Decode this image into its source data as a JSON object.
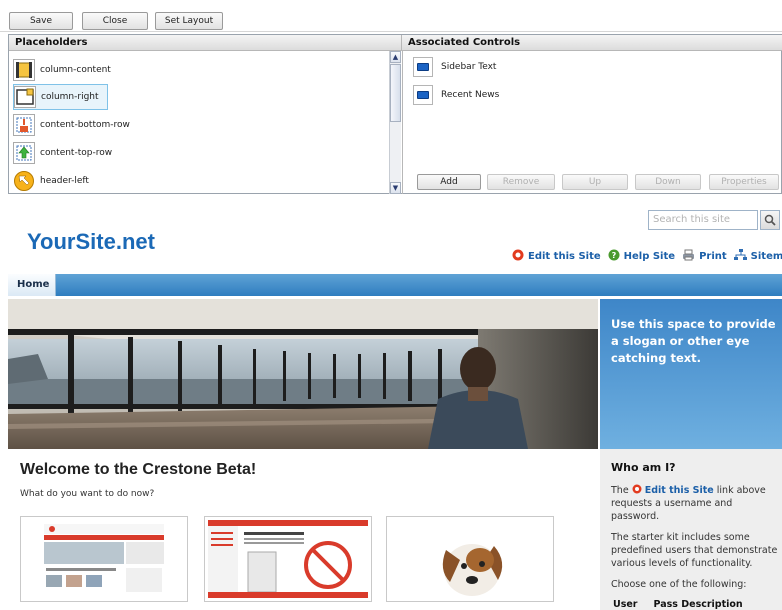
{
  "toolbar": {
    "save": "Save",
    "close": "Close",
    "set_layout": "Set Layout"
  },
  "placeholders": {
    "title": "Placeholders",
    "items": [
      {
        "label": "column-content",
        "icon": "column-content-icon",
        "selected": false
      },
      {
        "label": "column-right",
        "icon": "column-right-icon",
        "selected": true
      },
      {
        "label": "content-bottom-row",
        "icon": "content-bottom-row-icon",
        "selected": false
      },
      {
        "label": "content-top-row",
        "icon": "content-top-row-icon",
        "selected": false
      },
      {
        "label": "header-left",
        "icon": "header-left-icon",
        "selected": false
      }
    ]
  },
  "associated_controls": {
    "title": "Associated Controls",
    "items": [
      {
        "label": "Sidebar Text",
        "icon": "control-icon"
      },
      {
        "label": "Recent News",
        "icon": "control-icon"
      }
    ],
    "buttons": {
      "add": "Add",
      "remove": "Remove",
      "up": "Up",
      "down": "Down",
      "properties": "Properties"
    }
  },
  "site": {
    "logo": "YourSite.net",
    "search_placeholder": "Search this site",
    "links": {
      "edit": "Edit this Site",
      "help": "Help Site",
      "print": "Print",
      "sitemap": "Sitemap"
    },
    "nav": {
      "home": "Home"
    },
    "slogan": "Use this space to provide a slogan or other eye catching text.",
    "welcome": "Welcome to the Crestone Beta!",
    "what_to_do": "What do you want to do now?",
    "sidebar": {
      "title": "Who am I?",
      "p1_pre": "The",
      "p1_link": "Edit this Site",
      "p1_post": "link above requests a username and password.",
      "p2": "The starter kit includes some predefined users that demonstrate various levels of functionality.",
      "p3": "Choose one of the following:",
      "col_user": "User",
      "col_pass": "Pass",
      "col_desc": "Description"
    }
  },
  "colors": {
    "brand": "#1b69b6",
    "nav_blue": "#2f7dbf",
    "slogan_bg": "#4a90d0"
  }
}
